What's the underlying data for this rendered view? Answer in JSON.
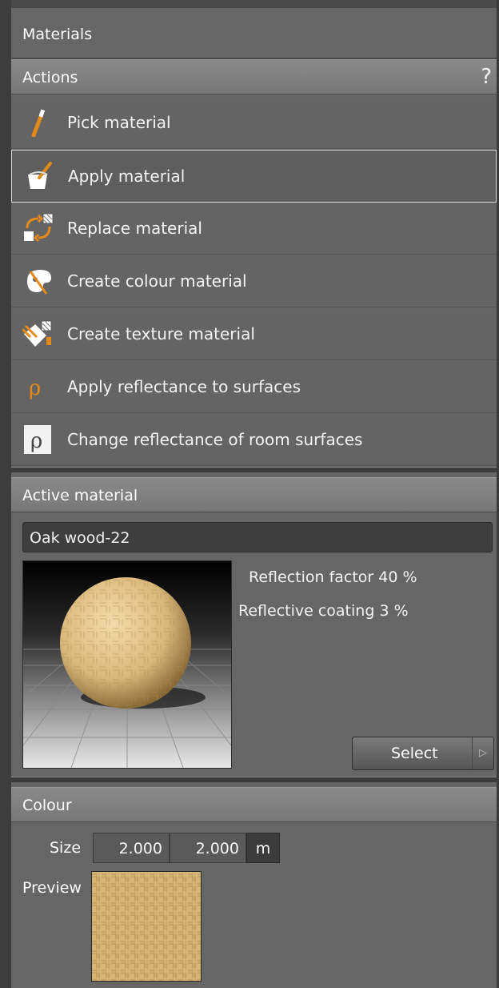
{
  "panel": {
    "title": "Materials"
  },
  "actions": {
    "header": "Actions",
    "help": "?",
    "items": [
      {
        "label": "Pick material",
        "icon": "eyedropper-icon"
      },
      {
        "label": "Apply material",
        "icon": "paint-bucket-icon"
      },
      {
        "label": "Replace material",
        "icon": "replace-arrows-icon"
      },
      {
        "label": "Create colour material",
        "icon": "palette-icon"
      },
      {
        "label": "Create texture material",
        "icon": "texture-icon"
      },
      {
        "label": "Apply reflectance to surfaces",
        "icon": "rho-icon"
      },
      {
        "label": "Change reflectance of room surfaces",
        "icon": "rho-box-icon"
      }
    ]
  },
  "active_material": {
    "header": "Active material",
    "name": "Oak wood-22",
    "reflection_factor_label": "Reflection factor",
    "reflection_factor_value": "40 %",
    "reflective_coating_label": "Reflective coating",
    "reflective_coating_value": "3 %",
    "select_label": "Select"
  },
  "colour": {
    "header": "Colour",
    "size_label": "Size",
    "size_x": "2.000",
    "size_y": "2.000",
    "unit": "m",
    "preview_label": "Preview"
  }
}
